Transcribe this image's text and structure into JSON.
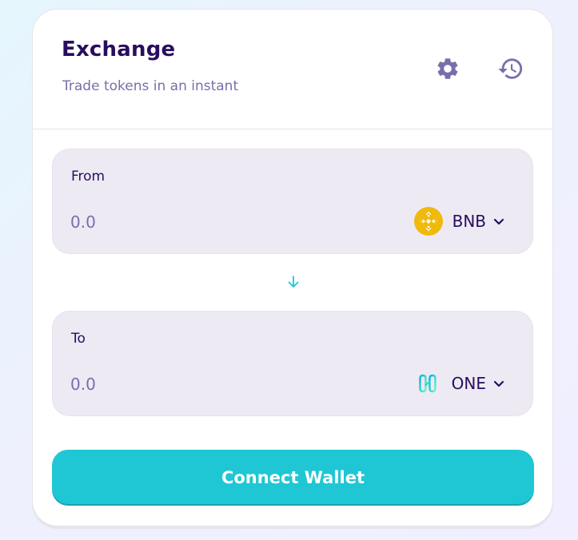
{
  "header": {
    "title": "Exchange",
    "subtitle": "Trade tokens in an instant",
    "settings_icon": "gear-icon",
    "history_icon": "history-icon"
  },
  "from": {
    "label": "From",
    "placeholder": "0.0",
    "value": "",
    "token": "BNB",
    "token_icon": "bnb-logo"
  },
  "swap": {
    "icon": "arrow-down-icon"
  },
  "to": {
    "label": "To",
    "placeholder": "0.0",
    "value": "",
    "token": "ONE",
    "token_icon": "harmony-one-logo"
  },
  "connect_button": {
    "label": "Connect Wallet"
  },
  "colors": {
    "title": "#280d5f",
    "subtitle": "#7a6eaa",
    "accent": "#1fc7d4",
    "panel": "#eeeaf4",
    "bnb": "#f0b90b"
  }
}
